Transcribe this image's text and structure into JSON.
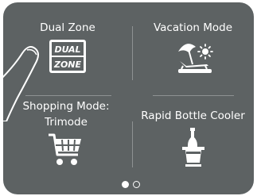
{
  "screen": {
    "tiles": [
      {
        "label": "Dual Zone",
        "icon": "dual-zone-icon",
        "icon_text_top": "DUAL",
        "icon_text_bottom": "ZONE"
      },
      {
        "label": "Vacation Mode",
        "icon": "vacation-icon"
      },
      {
        "label_line1": "Shopping Mode:",
        "label_line2": "Trimode",
        "icon": "shopping-cart-icon"
      },
      {
        "label": "Rapid Bottle Cooler",
        "icon": "bottle-cooler-icon"
      }
    ],
    "pager": {
      "pages": 2,
      "active_page": 1
    }
  },
  "colors": {
    "background": "#5d6263",
    "foreground": "#ffffff",
    "divider": "#8e9293"
  }
}
